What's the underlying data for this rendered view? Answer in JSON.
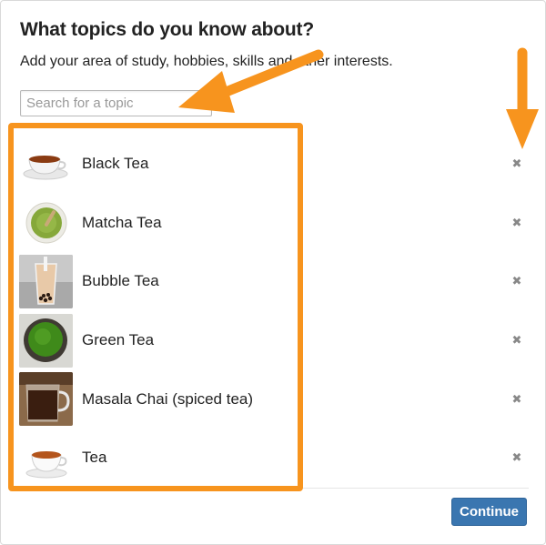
{
  "dialog": {
    "title": "What topics do you know about?",
    "subtitle": "Add your area of study, hobbies, skills and other interests."
  },
  "search": {
    "placeholder": "Search for a topic",
    "value": ""
  },
  "topics": [
    {
      "label": "Black Tea",
      "image": "black-tea-cup-image",
      "remove_icon": "close-icon"
    },
    {
      "label": "Matcha Tea",
      "image": "matcha-bowl-image",
      "remove_icon": "close-icon"
    },
    {
      "label": "Bubble Tea",
      "image": "bubble-tea-glass-image",
      "remove_icon": "close-icon"
    },
    {
      "label": "Green Tea",
      "image": "green-tea-bowl-image",
      "remove_icon": "close-icon"
    },
    {
      "label": "Masala Chai (spiced tea)",
      "image": "masala-chai-mug-image",
      "remove_icon": "close-icon"
    },
    {
      "label": "Tea",
      "image": "tea-cup-image",
      "remove_icon": "close-icon"
    }
  ],
  "remove_glyph": "✖",
  "footer": {
    "continue_label": "Continue"
  },
  "colors": {
    "annotation": "#f7941e",
    "primary_button": "#3a76b0"
  }
}
